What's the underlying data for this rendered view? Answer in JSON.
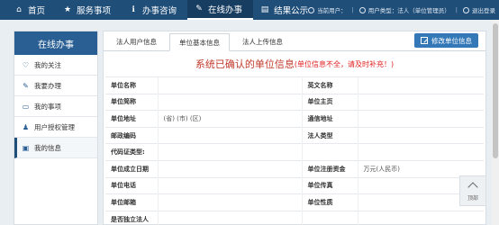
{
  "nav": {
    "items": [
      {
        "label": "首页",
        "icon": "home-icon",
        "glyph": "⌂"
      },
      {
        "label": "服务事项",
        "icon": "star-icon",
        "glyph": "★"
      },
      {
        "label": "办事咨询",
        "icon": "info-icon",
        "glyph": "ℹ"
      },
      {
        "label": "在线办事",
        "icon": "pencil-icon",
        "glyph": "✎"
      },
      {
        "label": "结果公示",
        "icon": "document-icon",
        "glyph": "▤"
      }
    ],
    "active_index": 3,
    "user_label": "当前用户：",
    "user_type": "用户类型：法人（单位管理员）",
    "logout": "退出登录"
  },
  "sidebar": {
    "title": "在线办事",
    "items": [
      {
        "label": "我的关注",
        "icon": "heart-icon",
        "glyph": "♡"
      },
      {
        "label": "我要办理",
        "icon": "edit-icon",
        "glyph": "✎"
      },
      {
        "label": "我的事项",
        "icon": "folder-icon",
        "glyph": "▭"
      },
      {
        "label": "用户授权管理",
        "icon": "user-icon",
        "glyph": "♟"
      },
      {
        "label": "我的信息",
        "icon": "id-card-icon",
        "glyph": "▣"
      }
    ],
    "active_index": 4
  },
  "tabs": {
    "items": [
      "法人用户信息",
      "单位基本信息",
      "法人上传信息"
    ],
    "active_index": 1
  },
  "edit_button": "修改单位信息",
  "title": "系统已确认的单位信息",
  "title_note": "(单位信息不全，请及时补充！)",
  "rows": [
    {
      "l1": "单位名称",
      "v1": "",
      "l2": "英文名称",
      "v2": ""
    },
    {
      "l1": "单位简称",
      "v1": "",
      "l2": "单位主页",
      "v2": ""
    },
    {
      "l1": "单位地址",
      "v1": "(省) (市) (区)",
      "l2": "通信地址",
      "v2": ""
    },
    {
      "l1": "邮政编码",
      "v1": "",
      "l2": "法人类型",
      "v2": ""
    },
    {
      "l1": "代码证类型:",
      "v1": "",
      "l2": "",
      "v2": ""
    },
    {
      "l1": "单位成立日期",
      "v1": "",
      "l2": "单位注册资金",
      "v2": "万元(人民币)"
    },
    {
      "l1": "单位电话",
      "v1": "",
      "l2": "单位传真",
      "v2": ""
    },
    {
      "l1": "单位邮箱",
      "v1": "",
      "l2": "单位性质",
      "v2": ""
    },
    {
      "l1": "是否独立法人",
      "v1": "",
      "l2": "",
      "v2": ""
    }
  ],
  "back_to_top": "顶部"
}
